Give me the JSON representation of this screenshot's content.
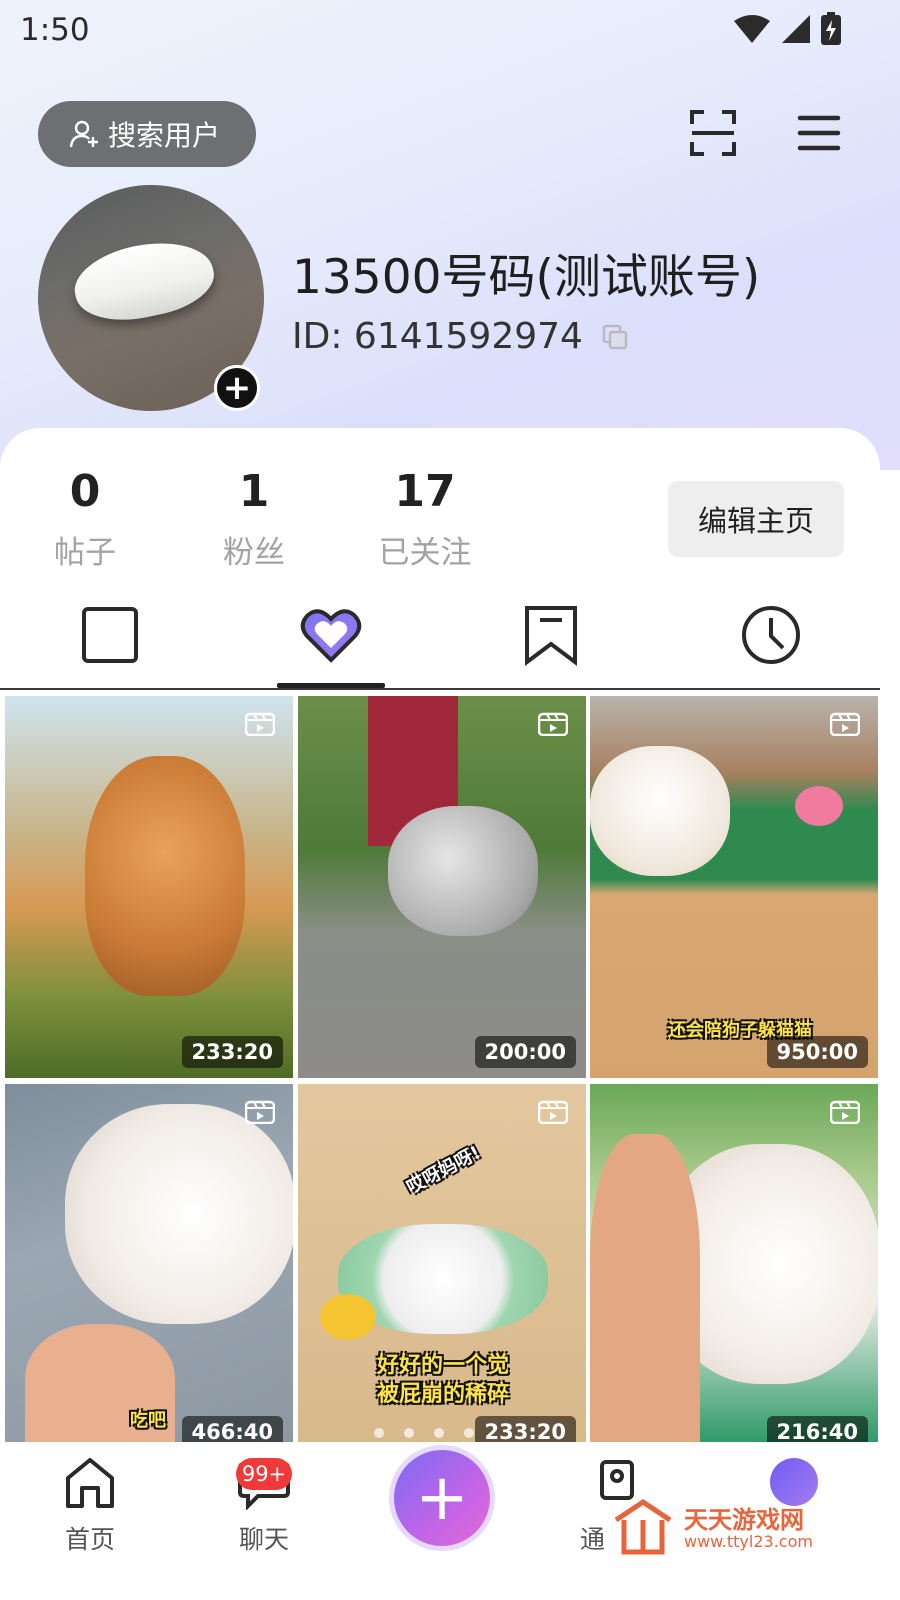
{
  "status_bar": {
    "time": "1:50"
  },
  "header": {
    "search_label": "搜索用户"
  },
  "profile": {
    "name": "13500号码(测试账号)",
    "id_text": "ID: 6141592974",
    "avatar_add_symbol": "+"
  },
  "stats": [
    {
      "value": "0",
      "label": "帖子"
    },
    {
      "value": "1",
      "label": "粉丝"
    },
    {
      "value": "17",
      "label": "已关注"
    }
  ],
  "edit_profile_label": "编辑主页",
  "tabs": [
    {
      "icon": "posts-square-icon",
      "selected": false
    },
    {
      "icon": "heart-icon",
      "selected": true
    },
    {
      "icon": "bookmark-icon",
      "selected": false
    },
    {
      "icon": "history-clock-icon",
      "selected": false
    }
  ],
  "grid": [
    {
      "duration": "233:20",
      "caption": ""
    },
    {
      "duration": "200:00",
      "caption": ""
    },
    {
      "duration": "950:00",
      "caption": "还会陪狗子躲猫猫"
    },
    {
      "duration": "466:40",
      "caption": "吃吧"
    },
    {
      "duration": "233:20",
      "caption": "好好的一个觉\n被屁崩的稀碎",
      "extra_caption": "哎呀妈呀!"
    },
    {
      "duration": "216:40",
      "caption": ""
    }
  ],
  "bottom_nav": {
    "home_label": "首页",
    "chat_label": "聊天",
    "chat_badge": "99+",
    "fab_symbol": "+",
    "notify_label_partial": "通"
  },
  "watermark": {
    "name": "天天游戏网",
    "url": "www.ttyl23.com"
  },
  "colors": {
    "accent_purple": "#8b7cf6",
    "badge_red": "#f03a3a",
    "watermark_orange": "#e8653b"
  }
}
